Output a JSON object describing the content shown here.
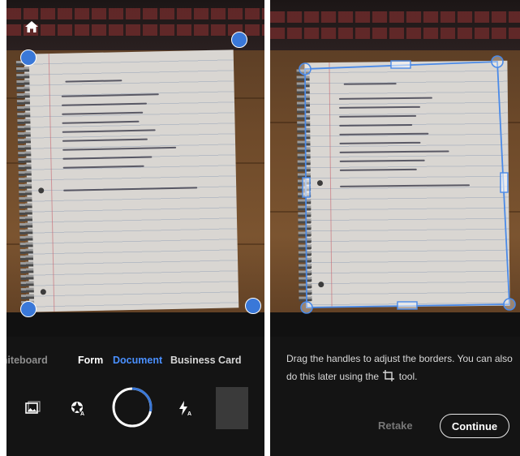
{
  "capture_screen": {
    "home_icon": "home-icon",
    "corner_handle_color": "#3a78d8",
    "modes": [
      {
        "label": "Whiteboard",
        "selected": false
      },
      {
        "label": "Form",
        "selected": false
      },
      {
        "label": "Document",
        "selected": true
      },
      {
        "label": "Business Card",
        "selected": false
      }
    ],
    "selected_mode_color": "#4a90ff",
    "toolbar_icons": [
      "gallery-icon",
      "auto-capture-icon",
      "shutter-button",
      "flash-auto-icon",
      "last-capture-thumbnail"
    ]
  },
  "crop_screen": {
    "hint_text_part1": "Drag the handles to adjust the borders. You can also do this later using the",
    "hint_text_part2": "tool.",
    "crop_tool_icon": "crop-icon",
    "retake_label": "Retake",
    "continue_label": "Continue",
    "border_color": "#4a8ae8"
  }
}
